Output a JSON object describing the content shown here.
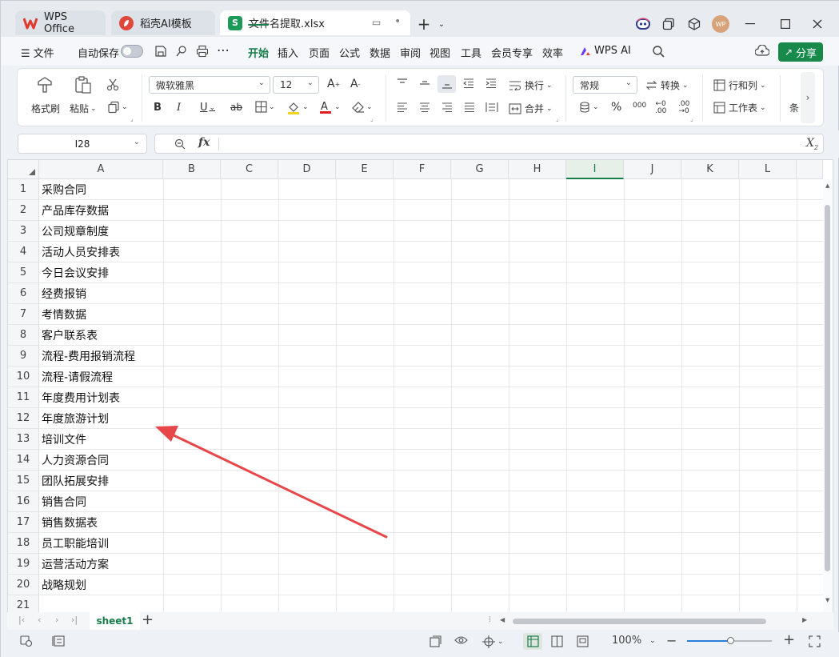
{
  "window": {
    "tabs": [
      {
        "label": "WPS Office",
        "icon": "wps-logo-icon"
      },
      {
        "label": "稻壳AI模板",
        "icon": "docer-icon"
      },
      {
        "label": "文件名提取.xlsx",
        "icon": "spreadsheet-icon",
        "icon_text": "S"
      }
    ],
    "add_tab": "+",
    "avatar_text": "WP"
  },
  "menubar": {
    "file": "文件",
    "autosave": "自动保存",
    "items": [
      "开始",
      "插入",
      "页面",
      "公式",
      "数据",
      "审阅",
      "视图",
      "工具",
      "会员专享",
      "效率"
    ],
    "wps_ai": "WPS AI",
    "share": "分享"
  },
  "ribbon": {
    "format_painter": "格式刷",
    "paste": "粘贴",
    "font_name": "微软雅黑",
    "font_size": "12",
    "wrap": "换行",
    "merge": "合并",
    "number_format": "常规",
    "convert": "转换",
    "rows_cols": "行和列",
    "worksheet": "工作表",
    "conditional": "条"
  },
  "formula_bar": {
    "cell_ref": "I28",
    "fx": "fx",
    "value": ""
  },
  "grid": {
    "columns": [
      "A",
      "B",
      "C",
      "D",
      "E",
      "F",
      "G",
      "H",
      "I",
      "J",
      "K",
      "L"
    ],
    "selected_column": "I",
    "row_numbers": [
      "1",
      "2",
      "3",
      "4",
      "5",
      "6",
      "7",
      "8",
      "9",
      "10",
      "11",
      "12",
      "13",
      "14",
      "15",
      "16",
      "17",
      "18",
      "19",
      "20",
      "21"
    ],
    "col_a_values": [
      "采购合同",
      "产品库存数据",
      "公司规章制度",
      "活动人员安排表",
      "今日会议安排",
      "经费报销",
      "考情数据",
      "客户联系表",
      "流程-费用报销流程",
      "流程-请假流程",
      "年度费用计划表",
      "年度旅游计划",
      "培训文件",
      "人力资源合同",
      "团队拓展安排",
      "销售合同",
      "销售数据表",
      "员工职能培训",
      "运营活动方案",
      "战略规划",
      ""
    ]
  },
  "sheets": {
    "active": "sheet1",
    "add": "+"
  },
  "statusbar": {
    "zoom": "100%"
  },
  "colors": {
    "accent": "#177d4a",
    "arrow": "#e8474a",
    "share_bg": "#17894b"
  }
}
